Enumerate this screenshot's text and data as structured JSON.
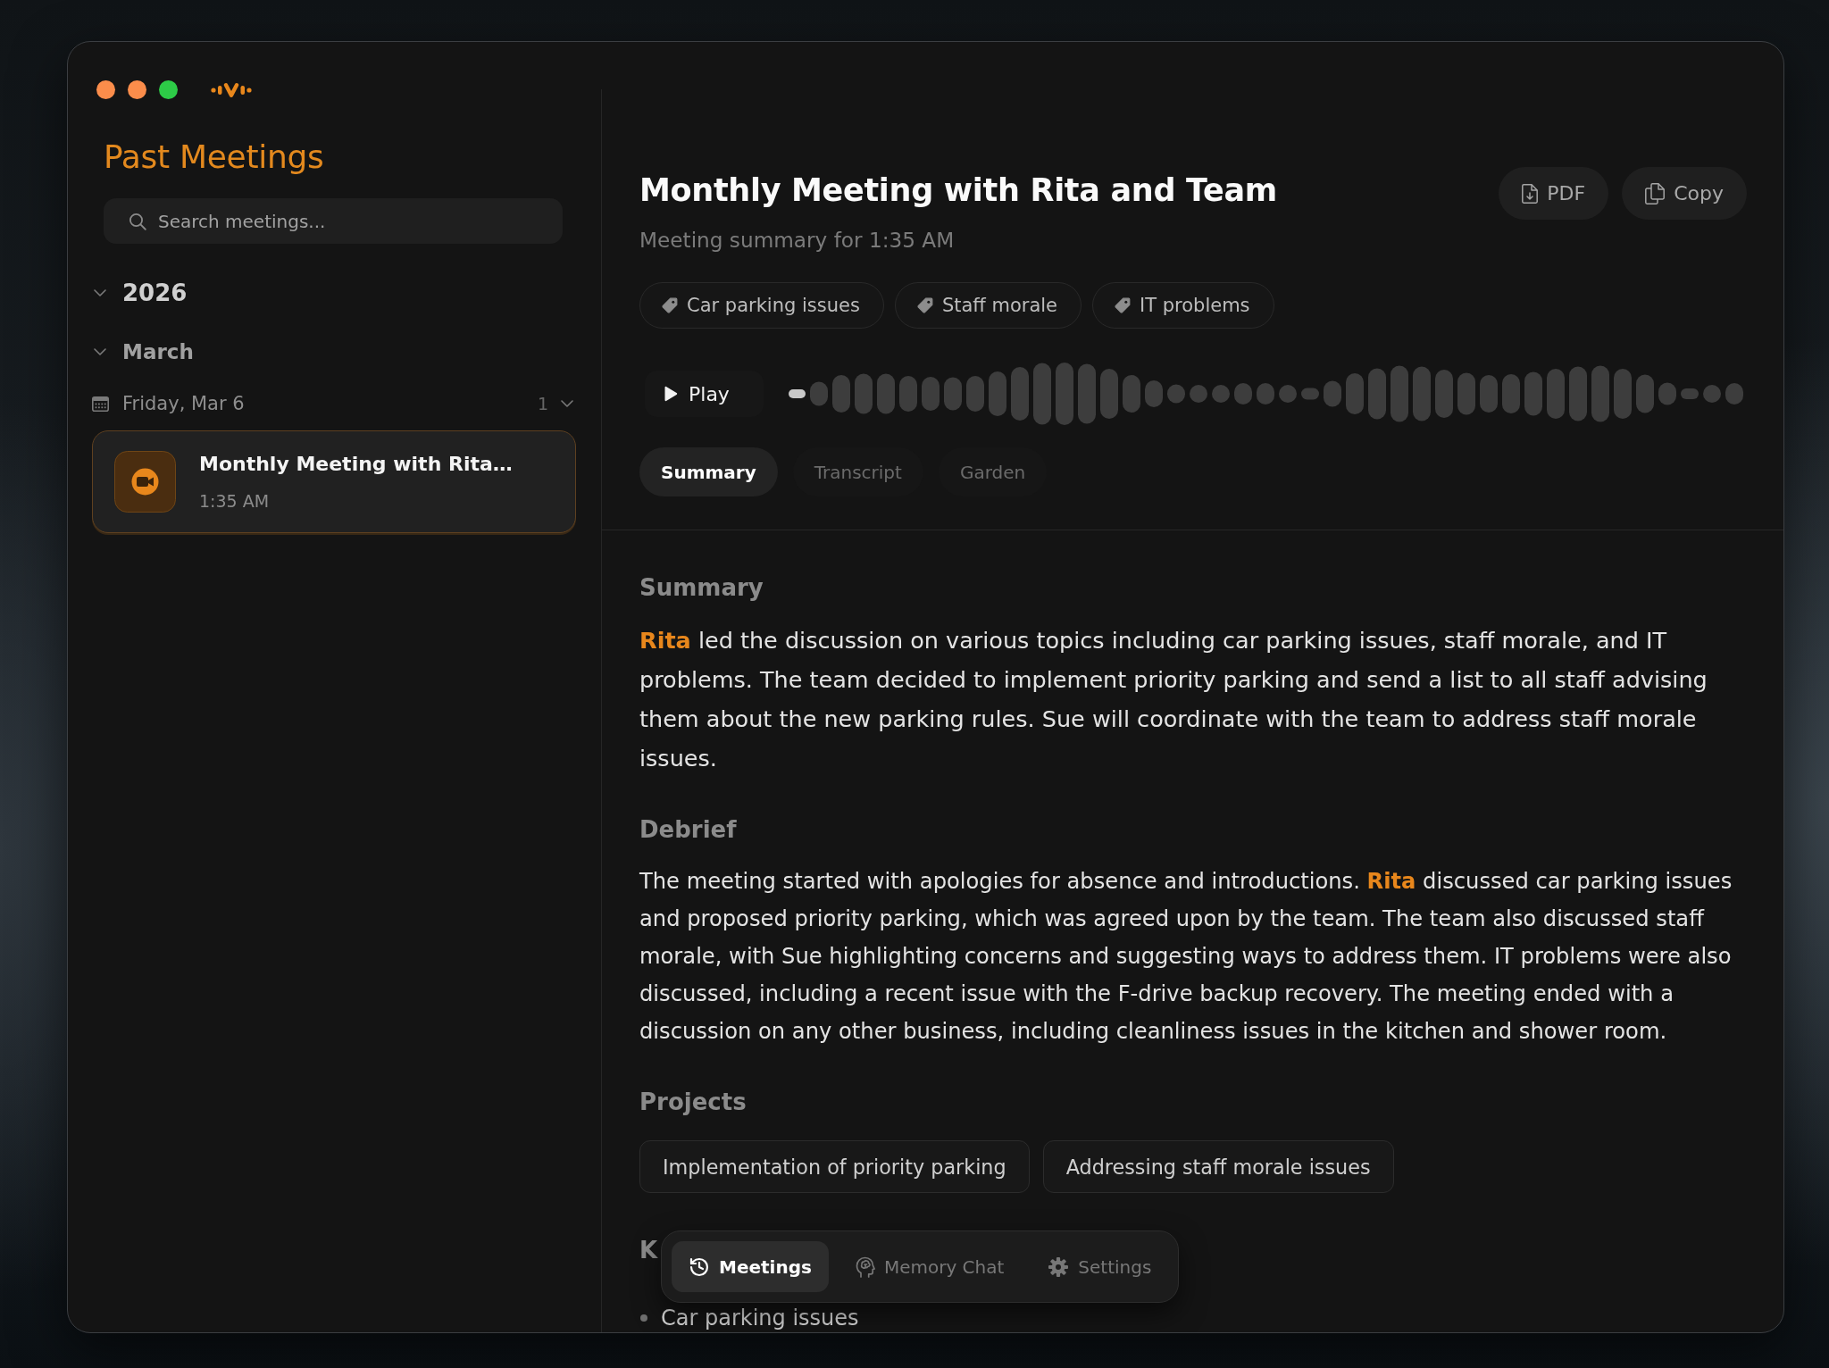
{
  "window": {
    "controls": [
      {
        "color": "#fb8d4b"
      },
      {
        "color": "#fb8d4b"
      },
      {
        "color": "#2dcb47"
      }
    ]
  },
  "sidebar": {
    "title": "Past Meetings",
    "search": {
      "placeholder": "Search meetings..."
    },
    "tree": [
      {
        "label": "2026",
        "expanded": true,
        "children": [
          {
            "label": "March",
            "expanded": true,
            "children": [
              {
                "label": "Friday, Mar 6",
                "count": "1",
                "expanded": true,
                "children": [
                  {
                    "title": "Monthly Meeting with Rita…",
                    "time": "1:35 AM",
                    "selected": true
                  }
                ]
              }
            ]
          }
        ]
      }
    ]
  },
  "meeting": {
    "title": "Monthly Meeting with Rita and Team",
    "subtitle": "Meeting summary for 1:35 AM",
    "actions": [
      {
        "label": "PDF"
      },
      {
        "label": "Copy"
      }
    ],
    "tags": [
      {
        "label": "Car parking issues"
      },
      {
        "label": "Staff morale"
      },
      {
        "label": "IT problems"
      }
    ],
    "player": {
      "label": "Play"
    },
    "tabs": [
      {
        "label": "Summary",
        "selected": true
      },
      {
        "label": "Transcript",
        "selected": false
      },
      {
        "label": "Garden",
        "selected": false
      }
    ]
  },
  "content": {
    "sections": [
      {
        "kind": "paragraph",
        "heading": "Summary",
        "text": "**Rita** led the discussion on various topics including car parking issues, staff morale, and IT problems. The team decided to implement priority parking and send a list to all staff advising them about the new parking rules. Sue will coordinate with the team to address staff morale issues."
      },
      {
        "kind": "paragraph",
        "heading": "Debrief",
        "text": "The meeting started with apologies for absence and introductions. **Rita** discussed car parking issues and proposed priority parking, which was agreed upon by the team. The team also discussed staff morale, with Sue highlighting concerns and suggesting ways to address them. IT problems were also discussed, including a recent issue with the F-drive backup recovery. The meeting ended with a discussion on any other business, including cleanliness issues in the kitchen and shower room."
      },
      {
        "kind": "chips",
        "heading": "Projects",
        "items": [
          "Implementation of priority parking",
          "Addressing staff morale issues"
        ]
      },
      {
        "kind": "bullets",
        "heading": "K",
        "items": [
          "Car parking issues"
        ]
      }
    ]
  },
  "nav": [
    {
      "label": "Meetings",
      "selected": true
    },
    {
      "label": "Memory Chat",
      "selected": false
    },
    {
      "label": "Settings",
      "selected": false
    }
  ]
}
